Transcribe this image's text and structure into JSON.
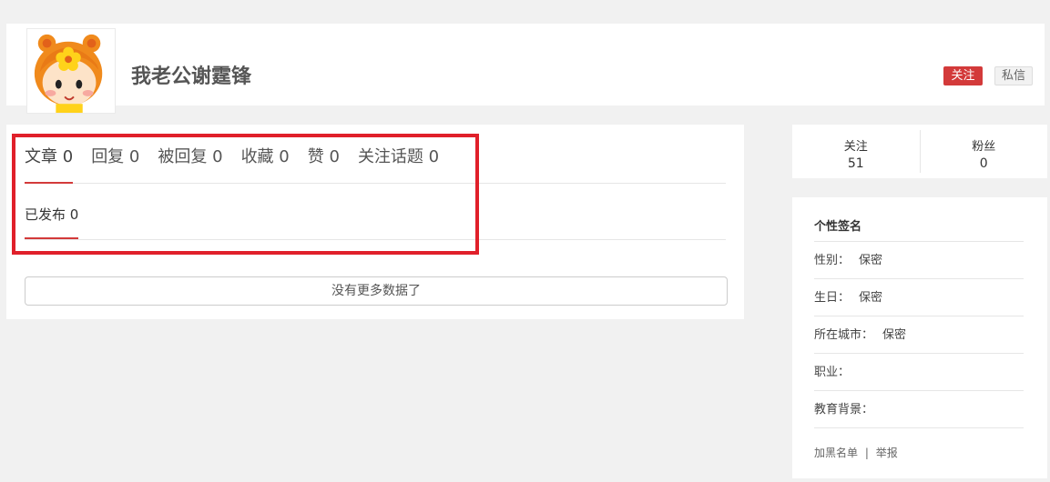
{
  "profile": {
    "username": "我老公谢霆锋",
    "follow_label": "关注",
    "message_label": "私信"
  },
  "tabs": [
    {
      "label": "文章 0"
    },
    {
      "label": "回复 0"
    },
    {
      "label": "被回复 0"
    },
    {
      "label": "收藏 0"
    },
    {
      "label": "赞 0"
    },
    {
      "label": "关注话题 0"
    }
  ],
  "subtabs": [
    {
      "label": "已发布 0"
    }
  ],
  "no_more_label": "没有更多数据了",
  "stats": {
    "following_label": "关注",
    "following_count": "51",
    "fans_label": "粉丝",
    "fans_count": "0"
  },
  "info": {
    "signature_title": "个性签名",
    "gender_label": "性别：",
    "gender_value": "保密",
    "birthday_label": "生日：",
    "birthday_value": "保密",
    "city_label": "所在城市：",
    "city_value": "保密",
    "job_label": "职业：",
    "education_label": "教育背景：",
    "footer_blacklist": "加黑名单",
    "footer_sep": "|",
    "footer_report": "举报"
  },
  "colors": {
    "accent": "#d33a3a",
    "highlight_box": "#e0202a",
    "background": "#f1f1f1"
  }
}
